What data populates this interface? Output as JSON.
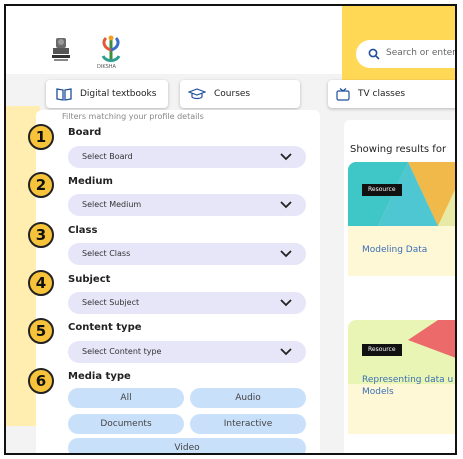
{
  "header": {
    "logo_text": "DIKSHA",
    "search_placeholder": "Search or enter QR"
  },
  "tabs": [
    {
      "label": "Digital textbooks",
      "icon": "book-icon"
    },
    {
      "label": "Courses",
      "icon": "graduation-cap-icon"
    },
    {
      "label": "TV classes",
      "icon": "tv-icon"
    }
  ],
  "filters": {
    "note": "Filters matching your profile details",
    "items": [
      {
        "number": "1",
        "label": "Board",
        "select": "Select Board"
      },
      {
        "number": "2",
        "label": "Medium",
        "select": "Select Medium"
      },
      {
        "number": "3",
        "label": "Class",
        "select": "Select Class"
      },
      {
        "number": "4",
        "label": "Subject",
        "select": "Select Subject"
      },
      {
        "number": "5",
        "label": "Content type",
        "select": "Select Content type"
      }
    ],
    "media": {
      "number": "6",
      "label": "Media type",
      "chips": [
        "All",
        "Audio",
        "Documents",
        "Interactive",
        "Video"
      ]
    }
  },
  "results": {
    "title": "Showing results for",
    "cards": [
      {
        "badge": "Resource",
        "title": "Modeling Data"
      },
      {
        "badge": "Resource",
        "title": "Representing data u Models"
      }
    ]
  },
  "colors": {
    "accent_yellow": "#ffd955",
    "number_circle": "#f6c33b",
    "select_bg": "#e7e5f8",
    "chip_bg": "#c9e0fb",
    "link_blue": "#3b6fb6"
  }
}
